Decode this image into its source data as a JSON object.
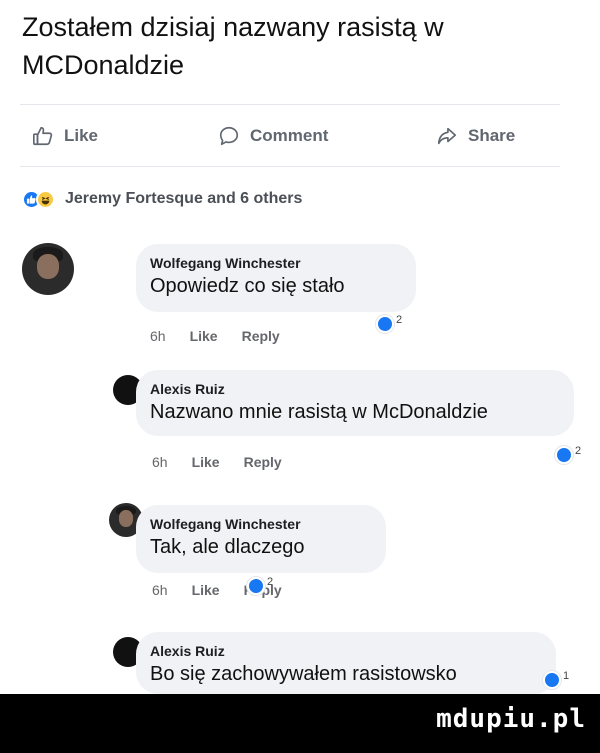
{
  "caption": "Zostałem dzisiaj nazwany rasistą w MCDonaldzie",
  "post_actions": {
    "like_label": "Like",
    "comment_label": "Comment",
    "share_label": "Share",
    "icons": [
      "thumbs-up-icon",
      "speech-bubble-icon",
      "share-arrow-icon"
    ]
  },
  "reactions": {
    "icons": [
      "like-reaction-icon",
      "haha-reaction-icon"
    ],
    "names": "Jeremy Fortesque and 6 others"
  },
  "comments": [
    {
      "author": "Wolfegang Winchester",
      "text": "Opowiedz co się stało",
      "time": "6h",
      "like_label": "Like",
      "reply_label": "Reply",
      "reaction_count": "2"
    },
    {
      "author": "Alexis Ruiz",
      "text": "Nazwano mnie rasistą w McDonaldzie",
      "time": "6h",
      "like_label": "Like",
      "reply_label": "Reply",
      "reaction_count": "2"
    },
    {
      "author": "Wolfegang Winchester",
      "text": "Tak, ale dlaczego",
      "time": "6h",
      "like_label": "Like",
      "reply_label": "Reply",
      "reaction_count": "2"
    },
    {
      "author": "Alexis Ruiz",
      "text": "Bo się zachowywałem rasistowsko",
      "reaction_count": "1"
    }
  ],
  "watermark": "mdupiu.pl",
  "colors": {
    "like_blue": "#1877f2",
    "bubble_bg": "#f0f2f5",
    "meta_gray": "#65676b",
    "footer_bg": "#000000"
  }
}
